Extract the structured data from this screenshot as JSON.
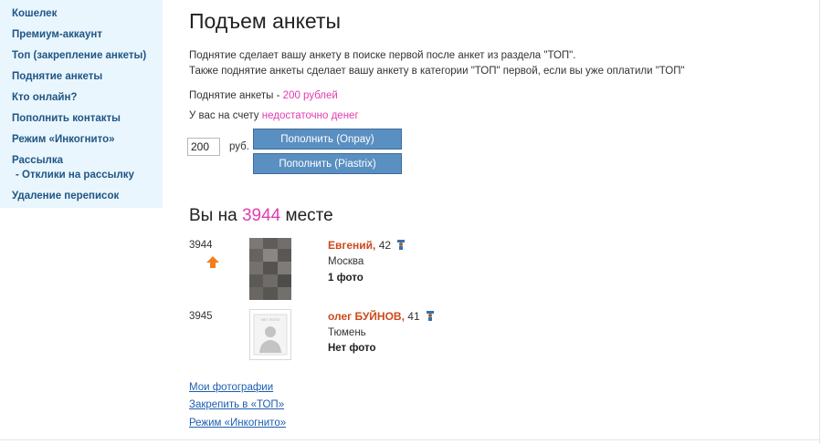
{
  "sidebar": {
    "items": [
      {
        "label": "Кошелек"
      },
      {
        "label": "Премиум-аккаунт"
      },
      {
        "label": "Топ (закрепление анкеты)"
      },
      {
        "label": "Поднятие анкеты"
      },
      {
        "label": "Кто онлайн?"
      },
      {
        "label": "Пополнить контакты"
      },
      {
        "label": "Режим «Инкогнито»"
      },
      {
        "label": "Рассылка"
      },
      {
        "label": "- Отклики на рассылку"
      },
      {
        "label": "Удаление переписок"
      }
    ]
  },
  "main": {
    "title": "Подъем анкеты",
    "desc_line1": "Поднятие сделает вашу анкету в поиске первой после анкет из раздела \"ТОП\".",
    "desc_line2": "Также поднятие анкеты сделает вашу анкету в категории \"ТОП\" первой, если вы уже оплатили \"ТОП\"",
    "lift_label": "Поднятие анкеты -",
    "lift_price": "200 рублей",
    "balance_label": "У вас на счету",
    "balance_status": "недостаточно денег",
    "amount_value": "200",
    "currency": "руб.",
    "btn_onpay": "Пополнить (Onpay)",
    "btn_piastrix": "Пополнить (Piastrix)",
    "place_prefix": "Вы на",
    "place_number": "3944",
    "place_suffix": "месте"
  },
  "profiles": [
    {
      "rank": "3944",
      "name": "Евгений,",
      "age": "42",
      "city": "Москва",
      "photos": "1 фото"
    },
    {
      "rank": "3945",
      "name": "олег БУЙНОВ,",
      "age": "41",
      "city": "Тюмень",
      "photos": "Нет фото",
      "placeholder_text": "НЕТ ФОТО"
    }
  ],
  "links": {
    "my_photos": "Мои фотографии",
    "pin_top": "Закрепить в «ТОП»",
    "incognito": "Режим «Инкогнито»"
  },
  "colors": {
    "sidebar_bg": "#eaf6fd",
    "link": "#1e5585",
    "accent_pink": "#e33bb0",
    "name_orange": "#cc4a1b",
    "button": "#5a8fc2",
    "arrow": "#f07f1a"
  },
  "icons": {
    "up_arrow": "arrow-up-icon",
    "gender": "male-icon"
  }
}
